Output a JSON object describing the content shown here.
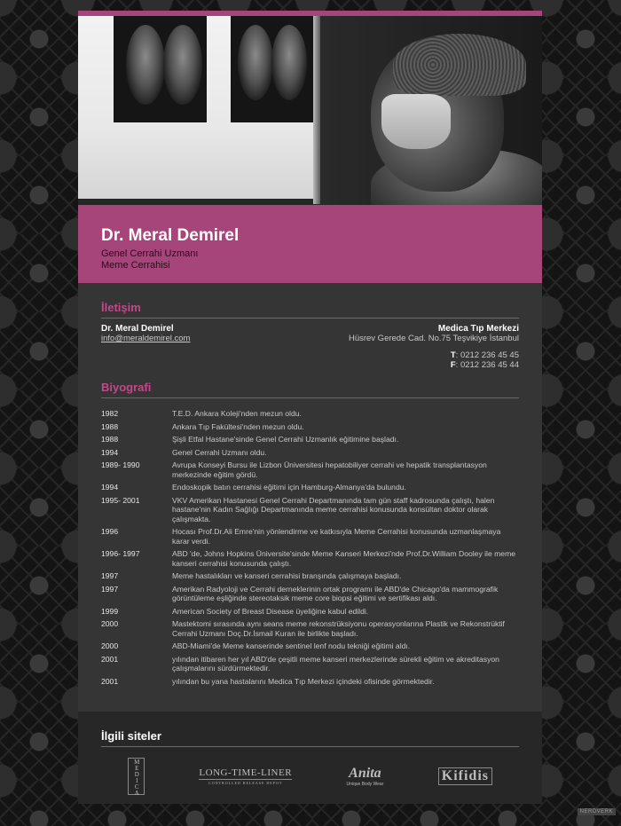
{
  "header": {
    "name": "Dr. Meral Demirel",
    "title_line1": "Genel Cerrahi Uzmanı",
    "title_line2": "Meme Cerrahisi"
  },
  "contact": {
    "heading": "İletişim",
    "person_name": "Dr. Meral Demirel",
    "email": "info@meraldemirel.com",
    "center_name": "Medica Tıp Merkezi",
    "address": "Hüsrev Gerede Cad. No.75 Teşvikiye İstanbul",
    "phone_label": "T",
    "phone": ": 0212 236 45 45",
    "fax_label": "F",
    "fax": ": 0212 236 45 44"
  },
  "bio": {
    "heading": "Biyografi",
    "entries": [
      {
        "year": "1982",
        "text": "T.E.D. Ankara Koleji'nden mezun oldu."
      },
      {
        "year": "1988",
        "text": "Ankara Tıp Fakültesi'nden mezun oldu."
      },
      {
        "year": "1988",
        "text": "Şişli Etfal Hastane'sinde Genel Cerrahi Uzmanlık eğitimine başladı."
      },
      {
        "year": "1994",
        "text": "Genel Cerrahi Uzmanı oldu."
      },
      {
        "year": "1989- 1990",
        "text": "Avrupa Konseyi Bursu ile Lizbon Üniversitesi hepatobiliyer cerrahi ve hepatik transplantasyon merkezinde eğitim gördü."
      },
      {
        "year": "1994",
        "text": "Endoskopik batın cerrahisi eğitimi için Hamburg-Almanya'da bulundu."
      },
      {
        "year": "1995- 2001",
        "text": "VKV Amerikan Hastanesi Genel Cerrahi Departmanında tam gün staff kadrosunda çalıştı, halen hastane'nin Kadın Sağlığı Departmanında meme cerrahisi konusunda konsültan doktor olarak çalışmakta."
      },
      {
        "year": "1996",
        "text": "Hocası Prof.Dr.Ali Emre'nin yönlendirme ve katkısıyla Meme Cerrahisi konusunda uzmanlaşmaya karar verdi."
      },
      {
        "year": "1996- 1997",
        "text": "ABD 'de, Johns Hopkins Üniversite'sinde Meme Kanseri Merkezi'nde Prof.Dr.William Dooley ile meme kanseri cerrahisi konusunda çalıştı."
      },
      {
        "year": "1997",
        "text": "Meme hastalıkları ve kanseri cerrahisi branşında çalışmaya başladı."
      },
      {
        "year": "1997",
        "text": "Amerikan Radyoloji ve Cerrahi derneklerinin ortak programı ile ABD'de Chicago'da mammografik görüntüleme eşliğinde stereotaksik meme core biopsi eğitimi ve sertifikası aldı."
      },
      {
        "year": "1999",
        "text": "American Society of Breast Disease üyeliğine kabul edildi."
      },
      {
        "year": "2000",
        "text": "Mastektomi sırasında aynı seans meme rekonstrüksiyonu operasyonlarına Plastik ve Rekonstrüktif Cerrahi Uzmanı Doç.Dr.İsmail Kuran ile birlikte başladı."
      },
      {
        "year": "2000",
        "text": "ABD-Miami'de Meme kanserinde sentinel lenf nodu tekniği eğitimi aldı."
      },
      {
        "year": "2001",
        "text": "yılından itibaren her yıl ABD'de çeşitli meme kanseri merkezlerinde sürekli eğitim ve akreditasyon çalışmalarını sürdürmektedir."
      },
      {
        "year": "2001",
        "text": "yılından bu yana hastalarını Medica Tıp Merkezi içindeki ofisinde görmektedir."
      }
    ]
  },
  "related": {
    "heading": "İlgili siteler",
    "logos": {
      "medica": "MEDICA",
      "longtimeliner": "LONG-TIME-LINER",
      "longtimeliner_sub": "CONTROLLED RELEASE DEPOT",
      "anita": "Anita",
      "anita_sub": "Unique Body Wear",
      "kifidis": "Kifidis"
    }
  },
  "credit": "NERDVERK",
  "colors": {
    "accent": "#a6457a",
    "heading": "#c2488a",
    "panel": "#353535",
    "footer": "#272727"
  }
}
